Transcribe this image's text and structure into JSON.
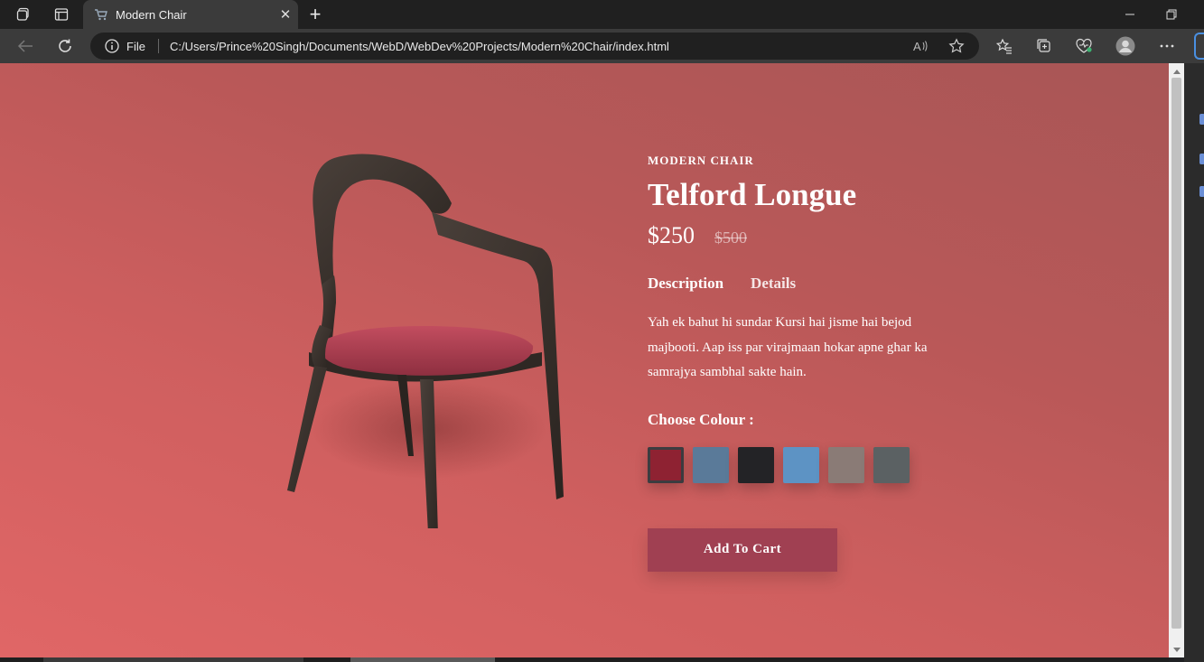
{
  "browser": {
    "tab_title": "Modern Chair",
    "address_scheme": "File",
    "url": "C:/Users/Prince%20Singh/Documents/WebD/WebDev%20Projects/Modern%20Chair/index.html"
  },
  "product": {
    "eyebrow": "MODERN CHAIR",
    "name": "Telford Longue",
    "price": "$250",
    "old_price": "$500",
    "tabs": [
      {
        "label": "Description"
      },
      {
        "label": "Details"
      }
    ],
    "description": "Yah ek bahut hi sundar Kursi hai jisme hai bejod majbooti. Aap iss par virajmaan hokar apne ghar ka samrajya sambhal sakte hain.",
    "colour_label": "Choose Colour :",
    "colours": [
      {
        "name": "maroon-fabric",
        "hex": "#8e2232",
        "selected": true
      },
      {
        "name": "denim-fabric",
        "hex": "#5a7a99",
        "selected": false
      },
      {
        "name": "black-fabric",
        "hex": "#232326",
        "selected": false
      },
      {
        "name": "light-blue-fabric",
        "hex": "#5d93c4",
        "selected": false
      },
      {
        "name": "taupe-fabric",
        "hex": "#8a7b76",
        "selected": false
      },
      {
        "name": "grey-fabric",
        "hex": "#5b6163",
        "selected": false
      }
    ],
    "cart_label": "Add To Cart"
  },
  "theme": {
    "background": "#cf5f5f",
    "button": "#a04052",
    "text": "#ffffff"
  }
}
